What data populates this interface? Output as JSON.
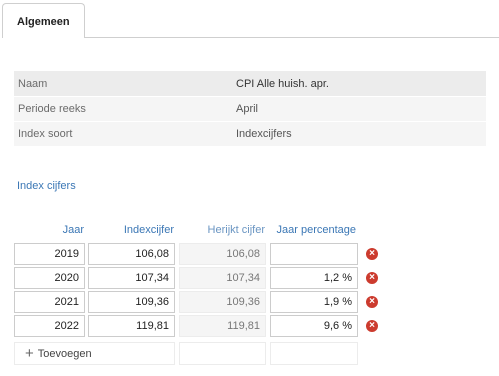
{
  "tabs": [
    {
      "label": "Algemeen"
    }
  ],
  "info": {
    "rows": [
      {
        "label": "Naam",
        "value": "CPI Alle huish. apr."
      },
      {
        "label": "Periode reeks",
        "value": "April"
      },
      {
        "label": "Index soort",
        "value": "Indexcijfers"
      }
    ]
  },
  "section": {
    "title": "Index cijfers"
  },
  "grid": {
    "headers": {
      "jaar": "Jaar",
      "index": "Indexcijfer",
      "herijkt": "Herijkt cijfer",
      "pct": "Jaar percentage"
    },
    "rows": [
      {
        "jaar": "2019",
        "index": "106,08",
        "herijkt": "106,08",
        "pct": ""
      },
      {
        "jaar": "2020",
        "index": "107,34",
        "herijkt": "107,34",
        "pct": "1,2 %"
      },
      {
        "jaar": "2021",
        "index": "109,36",
        "herijkt": "109,36",
        "pct": "1,9 %"
      },
      {
        "jaar": "2022",
        "index": "119,81",
        "herijkt": "119,81",
        "pct": "9,6 %"
      }
    ],
    "add_label": "Toevoegen"
  },
  "icons": {
    "delete": "delete-x-circle-icon",
    "add": "plus-icon"
  },
  "colors": {
    "accent": "#3b77b5",
    "delete": "#cc3b2e"
  }
}
